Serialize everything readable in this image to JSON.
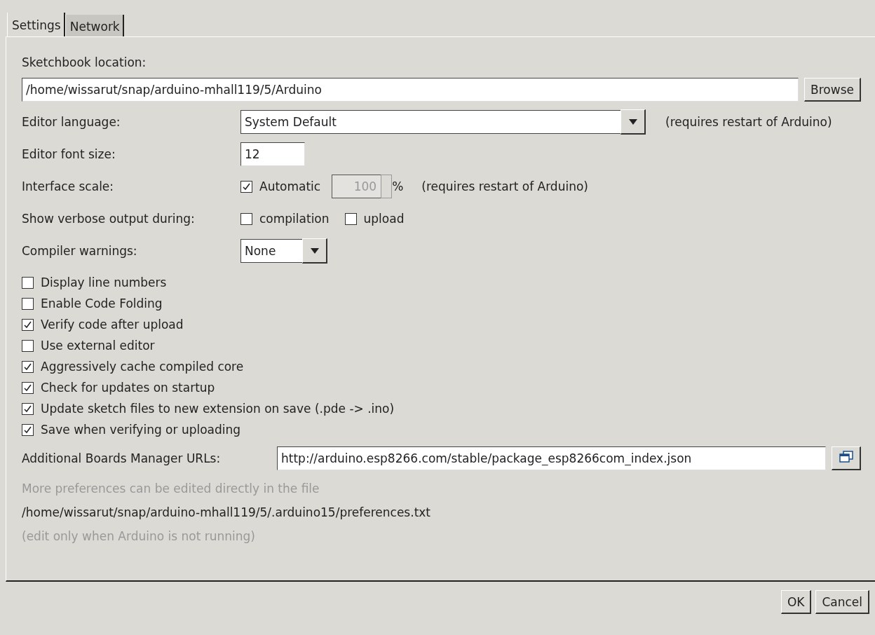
{
  "tabs": [
    {
      "label": "Settings",
      "selected": true
    },
    {
      "label": "Network",
      "selected": false
    }
  ],
  "sketchbook": {
    "label": "Sketchbook location:",
    "value": "/home/wissarut/snap/arduino-mhall119/5/Arduino",
    "button": "Browse"
  },
  "editor_language": {
    "label": "Editor language:",
    "value": "System Default",
    "note": "(requires restart of Arduino)"
  },
  "font_size": {
    "label": "Editor font size:",
    "value": "12"
  },
  "interface_scale": {
    "label": "Interface scale:",
    "automatic": {
      "label": "Automatic",
      "checked": true
    },
    "value": "100",
    "disabled": true,
    "unit": "%",
    "note": "(requires restart of Arduino)"
  },
  "verbose": {
    "label": "Show verbose output during:",
    "options": [
      {
        "label": "compilation",
        "checked": false
      },
      {
        "label": "upload",
        "checked": false
      }
    ]
  },
  "compiler_warnings": {
    "label": "Compiler warnings:",
    "value": "None"
  },
  "options": [
    {
      "label": "Display line numbers",
      "checked": false
    },
    {
      "label": "Enable Code Folding",
      "checked": false
    },
    {
      "label": "Verify code after upload",
      "checked": true
    },
    {
      "label": "Use external editor",
      "checked": false
    },
    {
      "label": "Aggressively cache compiled core",
      "checked": true
    },
    {
      "label": "Check for updates on startup",
      "checked": true
    },
    {
      "label": "Update sketch files to new extension on save (.pde -> .ino)",
      "checked": true
    },
    {
      "label": "Save when verifying or uploading",
      "checked": true
    }
  ],
  "boards_urls": {
    "label": "Additional Boards Manager URLs:",
    "value": "http://arduino.esp8266.com/stable/package_esp8266com_index.json"
  },
  "info": [
    {
      "text": "More preferences can be edited directly in the file",
      "muted": true
    },
    {
      "text": "/home/wissarut/snap/arduino-mhall119/5/.arduino15/preferences.txt",
      "muted": false
    },
    {
      "text": "(edit only when Arduino is not running)",
      "muted": true
    }
  ],
  "buttons": [
    "OK",
    "Cancel"
  ]
}
